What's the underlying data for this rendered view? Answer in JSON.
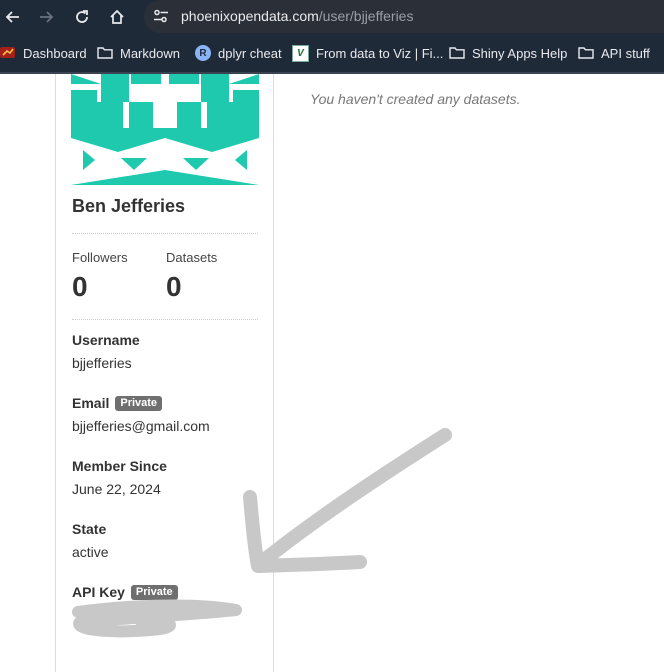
{
  "browser": {
    "url_domain": "phoenixopendata.com",
    "url_path": "/user/bjjefferies"
  },
  "bookmarks": [
    {
      "label": "Dashboard",
      "icon": "dashboard-favicon"
    },
    {
      "label": "Markdown",
      "icon": "folder-icon"
    },
    {
      "label": "dplyr cheat",
      "icon": "r-favicon"
    },
    {
      "label": "From data to Viz | Fi...",
      "icon": "viz-favicon"
    },
    {
      "label": "Shiny Apps Help",
      "icon": "folder-icon"
    },
    {
      "label": "API stuff",
      "icon": "folder-icon"
    }
  ],
  "profile": {
    "name": "Ben Jefferies",
    "followers_label": "Followers",
    "followers_count": "0",
    "datasets_label": "Datasets",
    "datasets_count": "0",
    "username_label": "Username",
    "username": "bjjefferies",
    "email_label": "Email",
    "email": "bjjefferies@gmail.com",
    "member_since_label": "Member Since",
    "member_since": "June 22, 2024",
    "state_label": "State",
    "state": "active",
    "api_key_label": "API Key",
    "private_badge": "Private"
  },
  "main": {
    "empty_message": "You haven't created any datasets."
  },
  "colors": {
    "chrome_bg": "#1f2a39",
    "avatar_teal": "#1ec9ad",
    "badge_gray": "#6f6f6f",
    "annotation_gray": "#c8c8c8"
  }
}
